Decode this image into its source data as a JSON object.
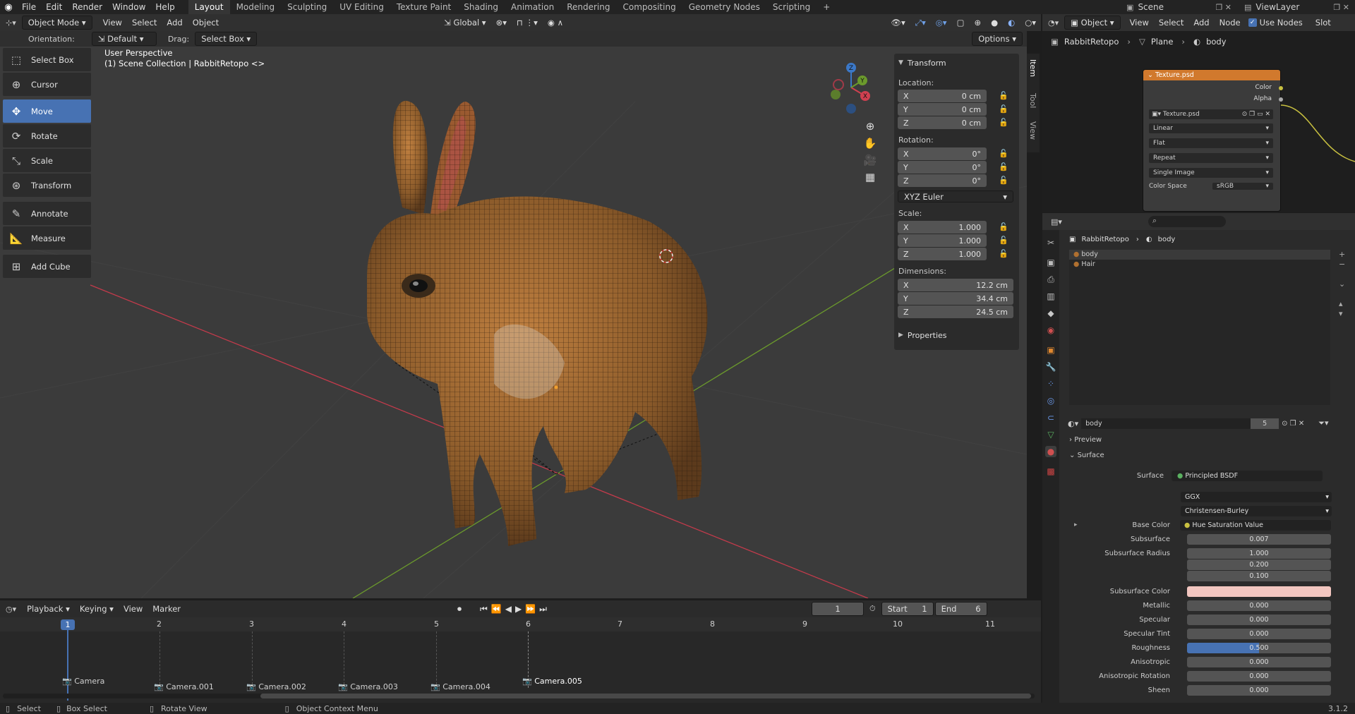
{
  "topbar": {
    "menus": [
      "File",
      "Edit",
      "Render",
      "Window",
      "Help"
    ],
    "workspaces": [
      "Layout",
      "Modeling",
      "Sculpting",
      "UV Editing",
      "Texture Paint",
      "Shading",
      "Animation",
      "Rendering",
      "Compositing",
      "Geometry Nodes",
      "Scripting"
    ],
    "active_workspace": "Layout",
    "add_tab": "+",
    "scene": "Scene",
    "view_layer": "ViewLayer"
  },
  "viewport_header": {
    "mode": "Object Mode",
    "menus": [
      "View",
      "Select",
      "Add",
      "Object"
    ],
    "transform_orientation": "Global",
    "orientation_label": "Orientation:",
    "orientation_value": "Default",
    "drag_label": "Drag:",
    "drag_value": "Select Box",
    "options": "Options"
  },
  "viewport": {
    "title": "User Perspective",
    "subtitle": "(1) Scene Collection | RabbitRetopo <>"
  },
  "toolbar": {
    "tools": [
      {
        "label": "Select Box",
        "icon": "select-box-icon"
      },
      {
        "label": "Cursor",
        "icon": "cursor-icon"
      },
      {
        "label": "Move",
        "icon": "move-icon"
      },
      {
        "label": "Rotate",
        "icon": "rotate-icon"
      },
      {
        "label": "Scale",
        "icon": "scale-icon"
      },
      {
        "label": "Transform",
        "icon": "transform-icon"
      },
      {
        "label": "Annotate",
        "icon": "annotate-icon"
      },
      {
        "label": "Measure",
        "icon": "measure-icon"
      },
      {
        "label": "Add Cube",
        "icon": "add-cube-icon"
      }
    ],
    "active_tool": "Move"
  },
  "npanel": {
    "tabs": [
      "Item",
      "Tool",
      "View"
    ],
    "transform_title": "Transform",
    "location_label": "Location:",
    "location": [
      {
        "axis": "X",
        "value": "0 cm"
      },
      {
        "axis": "Y",
        "value": "0 cm"
      },
      {
        "axis": "Z",
        "value": "0 cm"
      }
    ],
    "rotation_label": "Rotation:",
    "rotation": [
      {
        "axis": "X",
        "value": "0°"
      },
      {
        "axis": "Y",
        "value": "0°"
      },
      {
        "axis": "Z",
        "value": "0°"
      }
    ],
    "rotation_mode": "XYZ Euler",
    "scale_label": "Scale:",
    "scale": [
      {
        "axis": "X",
        "value": "1.000"
      },
      {
        "axis": "Y",
        "value": "1.000"
      },
      {
        "axis": "Z",
        "value": "1.000"
      }
    ],
    "dimensions_label": "Dimensions:",
    "dimensions": [
      {
        "axis": "X",
        "value": "12.2 cm"
      },
      {
        "axis": "Y",
        "value": "34.4 cm"
      },
      {
        "axis": "Z",
        "value": "24.5 cm"
      }
    ],
    "properties_title": "Properties"
  },
  "gizmo": {
    "x": "X",
    "y": "Y",
    "z": "Z"
  },
  "timeline": {
    "menus": [
      "Playback",
      "Keying",
      "View",
      "Marker"
    ],
    "current_frame": "1",
    "start_label": "Start",
    "start": "1",
    "end_label": "End",
    "end": "6",
    "ruler": [
      "1",
      "2",
      "3",
      "4",
      "5",
      "6",
      "7",
      "8",
      "9",
      "10",
      "11"
    ],
    "markers": [
      "Camera",
      "Camera.001",
      "Camera.002",
      "Camera.003",
      "Camera.004",
      "Camera.005"
    ]
  },
  "statusbar": {
    "select": "Select",
    "box_select": "Box Select",
    "rotate_view": "Rotate View",
    "context_menu": "Object Context Menu",
    "version": "3.1.2"
  },
  "node_editor": {
    "object_type": "Object",
    "menus": [
      "View",
      "Select",
      "Add",
      "Node"
    ],
    "use_nodes_label": "Use Nodes",
    "slot": "Slot",
    "breadcrumb": [
      "RabbitRetopo",
      "Plane",
      "body"
    ],
    "node_title": "Texture.psd",
    "outputs": [
      "Color",
      "Alpha"
    ],
    "image_name": "Texture.psd",
    "interpolation": "Linear",
    "projection": "Flat",
    "extension": "Repeat",
    "source": "Single Image",
    "color_space_label": "Color Space",
    "color_space": "sRGB"
  },
  "properties": {
    "breadcrumb": [
      "RabbitRetopo",
      "body"
    ],
    "slots": [
      "body",
      "Hair"
    ],
    "material_name": "body",
    "users": "5",
    "preview_label": "Preview",
    "surface_section": "Surface",
    "surface_label": "Surface",
    "surface_value": "Principled BSDF",
    "distribution": "GGX",
    "subsurface_method": "Christensen-Burley",
    "base_color_label": "Base Color",
    "base_color_value": "Hue Saturation Value",
    "subsurface_label": "Subsurface",
    "subsurface_value": "0.007",
    "subsurface_radius_label": "Subsurface Radius",
    "subsurface_radius": [
      "1.000",
      "0.200",
      "0.100"
    ],
    "subsurface_color_label": "Subsurface Color",
    "subsurface_color": "#f2c6c0",
    "metallic_label": "Metallic",
    "metallic": "0.000",
    "specular_label": "Specular",
    "specular": "0.000",
    "specular_tint_label": "Specular Tint",
    "specular_tint": "0.000",
    "roughness_label": "Roughness",
    "roughness": "0.500",
    "anisotropic_label": "Anisotropic",
    "anisotropic": "0.000",
    "anisotropic_rotation_label": "Anisotropic Rotation",
    "anisotropic_rotation": "0.000",
    "sheen_label": "Sheen",
    "sheen": "0.000"
  },
  "colors": {
    "accent": "#4772b3",
    "node_header": "#d1792d",
    "x_axis": "#c23b4b",
    "y_axis": "#6b9a2c"
  }
}
